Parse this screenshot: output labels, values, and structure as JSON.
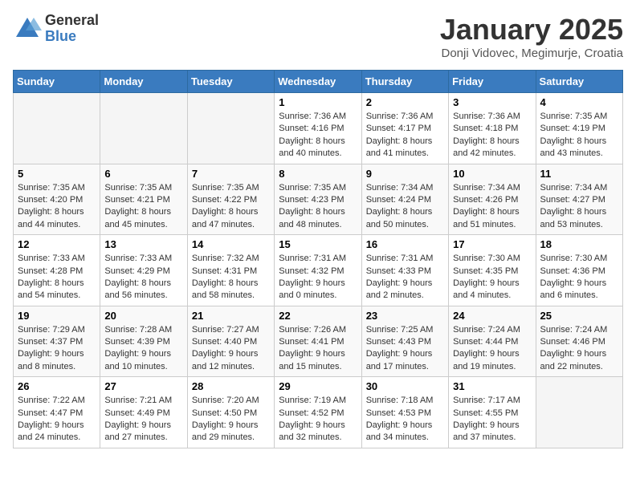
{
  "header": {
    "logo_general": "General",
    "logo_blue": "Blue",
    "month_title": "January 2025",
    "subtitle": "Donji Vidovec, Megimurje, Croatia"
  },
  "calendar": {
    "weekdays": [
      "Sunday",
      "Monday",
      "Tuesday",
      "Wednesday",
      "Thursday",
      "Friday",
      "Saturday"
    ],
    "weeks": [
      [
        {
          "day": "",
          "info": ""
        },
        {
          "day": "",
          "info": ""
        },
        {
          "day": "",
          "info": ""
        },
        {
          "day": "1",
          "info": "Sunrise: 7:36 AM\nSunset: 4:16 PM\nDaylight: 8 hours and 40 minutes."
        },
        {
          "day": "2",
          "info": "Sunrise: 7:36 AM\nSunset: 4:17 PM\nDaylight: 8 hours and 41 minutes."
        },
        {
          "day": "3",
          "info": "Sunrise: 7:36 AM\nSunset: 4:18 PM\nDaylight: 8 hours and 42 minutes."
        },
        {
          "day": "4",
          "info": "Sunrise: 7:35 AM\nSunset: 4:19 PM\nDaylight: 8 hours and 43 minutes."
        }
      ],
      [
        {
          "day": "5",
          "info": "Sunrise: 7:35 AM\nSunset: 4:20 PM\nDaylight: 8 hours and 44 minutes."
        },
        {
          "day": "6",
          "info": "Sunrise: 7:35 AM\nSunset: 4:21 PM\nDaylight: 8 hours and 45 minutes."
        },
        {
          "day": "7",
          "info": "Sunrise: 7:35 AM\nSunset: 4:22 PM\nDaylight: 8 hours and 47 minutes."
        },
        {
          "day": "8",
          "info": "Sunrise: 7:35 AM\nSunset: 4:23 PM\nDaylight: 8 hours and 48 minutes."
        },
        {
          "day": "9",
          "info": "Sunrise: 7:34 AM\nSunset: 4:24 PM\nDaylight: 8 hours and 50 minutes."
        },
        {
          "day": "10",
          "info": "Sunrise: 7:34 AM\nSunset: 4:26 PM\nDaylight: 8 hours and 51 minutes."
        },
        {
          "day": "11",
          "info": "Sunrise: 7:34 AM\nSunset: 4:27 PM\nDaylight: 8 hours and 53 minutes."
        }
      ],
      [
        {
          "day": "12",
          "info": "Sunrise: 7:33 AM\nSunset: 4:28 PM\nDaylight: 8 hours and 54 minutes."
        },
        {
          "day": "13",
          "info": "Sunrise: 7:33 AM\nSunset: 4:29 PM\nDaylight: 8 hours and 56 minutes."
        },
        {
          "day": "14",
          "info": "Sunrise: 7:32 AM\nSunset: 4:31 PM\nDaylight: 8 hours and 58 minutes."
        },
        {
          "day": "15",
          "info": "Sunrise: 7:31 AM\nSunset: 4:32 PM\nDaylight: 9 hours and 0 minutes."
        },
        {
          "day": "16",
          "info": "Sunrise: 7:31 AM\nSunset: 4:33 PM\nDaylight: 9 hours and 2 minutes."
        },
        {
          "day": "17",
          "info": "Sunrise: 7:30 AM\nSunset: 4:35 PM\nDaylight: 9 hours and 4 minutes."
        },
        {
          "day": "18",
          "info": "Sunrise: 7:30 AM\nSunset: 4:36 PM\nDaylight: 9 hours and 6 minutes."
        }
      ],
      [
        {
          "day": "19",
          "info": "Sunrise: 7:29 AM\nSunset: 4:37 PM\nDaylight: 9 hours and 8 minutes."
        },
        {
          "day": "20",
          "info": "Sunrise: 7:28 AM\nSunset: 4:39 PM\nDaylight: 9 hours and 10 minutes."
        },
        {
          "day": "21",
          "info": "Sunrise: 7:27 AM\nSunset: 4:40 PM\nDaylight: 9 hours and 12 minutes."
        },
        {
          "day": "22",
          "info": "Sunrise: 7:26 AM\nSunset: 4:41 PM\nDaylight: 9 hours and 15 minutes."
        },
        {
          "day": "23",
          "info": "Sunrise: 7:25 AM\nSunset: 4:43 PM\nDaylight: 9 hours and 17 minutes."
        },
        {
          "day": "24",
          "info": "Sunrise: 7:24 AM\nSunset: 4:44 PM\nDaylight: 9 hours and 19 minutes."
        },
        {
          "day": "25",
          "info": "Sunrise: 7:24 AM\nSunset: 4:46 PM\nDaylight: 9 hours and 22 minutes."
        }
      ],
      [
        {
          "day": "26",
          "info": "Sunrise: 7:22 AM\nSunset: 4:47 PM\nDaylight: 9 hours and 24 minutes."
        },
        {
          "day": "27",
          "info": "Sunrise: 7:21 AM\nSunset: 4:49 PM\nDaylight: 9 hours and 27 minutes."
        },
        {
          "day": "28",
          "info": "Sunrise: 7:20 AM\nSunset: 4:50 PM\nDaylight: 9 hours and 29 minutes."
        },
        {
          "day": "29",
          "info": "Sunrise: 7:19 AM\nSunset: 4:52 PM\nDaylight: 9 hours and 32 minutes."
        },
        {
          "day": "30",
          "info": "Sunrise: 7:18 AM\nSunset: 4:53 PM\nDaylight: 9 hours and 34 minutes."
        },
        {
          "day": "31",
          "info": "Sunrise: 7:17 AM\nSunset: 4:55 PM\nDaylight: 9 hours and 37 minutes."
        },
        {
          "day": "",
          "info": ""
        }
      ]
    ]
  }
}
